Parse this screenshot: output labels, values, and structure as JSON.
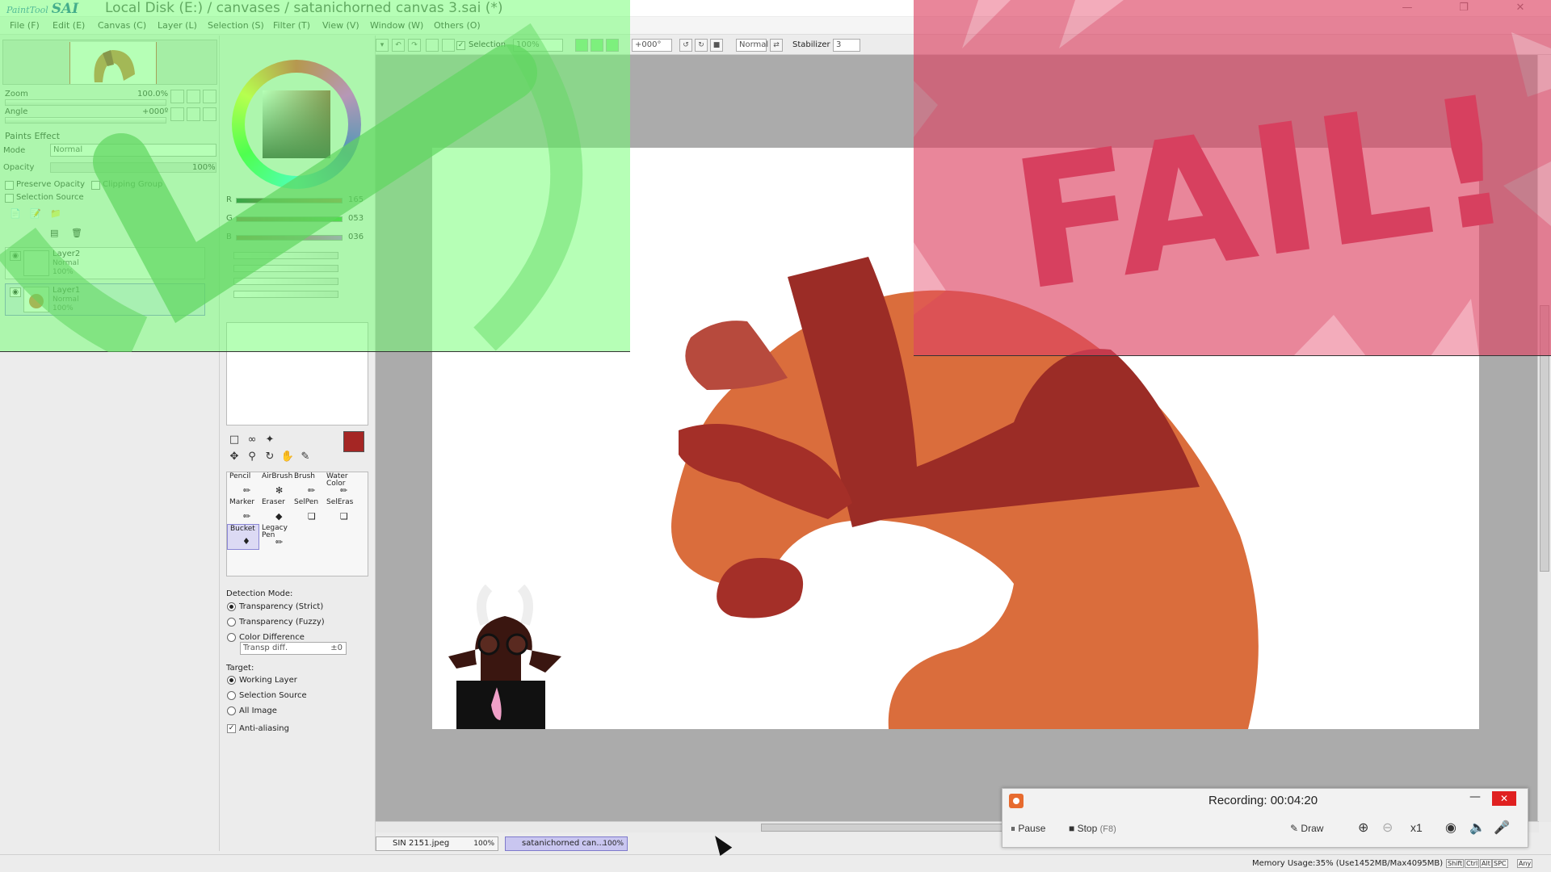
{
  "window": {
    "logo_small": "PaintTool",
    "logo_big": "SAI",
    "title": "Local Disk (E:) / canvases / satanichorned canvas 3.sai (*)",
    "btn_min": "—",
    "btn_max": "❐",
    "btn_close": "✕"
  },
  "menu": [
    "File (F)",
    "Edit (E)",
    "Canvas (C)",
    "Layer (L)",
    "Selection (S)",
    "Filter (T)",
    "View (V)",
    "Window (W)",
    "Others (O)"
  ],
  "navigator": {
    "zoom_label": "Zoom",
    "zoom_value": "100.0%",
    "angle_label": "Angle",
    "angle_value": "+000º"
  },
  "layer_panel": {
    "paints_effect": "Paints Effect",
    "mode_label": "Mode",
    "mode_value": "Normal",
    "opacity_label": "Opacity",
    "opacity_value": "100%",
    "preserve_opacity": "Preserve Opacity",
    "clipping_group": "Clipping Group",
    "selection_source": "Selection Source",
    "layers": [
      {
        "name": "Layer2",
        "mode": "Normal",
        "opacity": "100%"
      },
      {
        "name": "Layer1",
        "mode": "Normal",
        "opacity": "100%"
      }
    ]
  },
  "color": {
    "r_label": "R",
    "r_value": "165",
    "g_label": "G",
    "g_value": "053",
    "b_label": "B",
    "b_value": "036",
    "primary": "#a52624",
    "secondary": "#c49a8a"
  },
  "tools": [
    {
      "name": "Pencil",
      "icon": "pencil-icon"
    },
    {
      "name": "AirBrush",
      "icon": "airbrush-icon"
    },
    {
      "name": "Brush",
      "icon": "brush-icon"
    },
    {
      "name": "Water Color",
      "icon": "watercolor-icon"
    },
    {
      "name": "Marker",
      "icon": "marker-icon"
    },
    {
      "name": "Eraser",
      "icon": "eraser-icon"
    },
    {
      "name": "SelPen",
      "icon": "selpen-icon"
    },
    {
      "name": "SelEras",
      "icon": "seleras-icon"
    },
    {
      "name": "Bucket",
      "icon": "bucket-icon"
    },
    {
      "name": "Legacy Pen",
      "icon": "legacy-pen-icon"
    }
  ],
  "tool_options": {
    "detection_mode": "Detection Mode:",
    "modes": [
      "Transparency (Strict)",
      "Transparency (Fuzzy)",
      "Color Difference"
    ],
    "transp_diff_label": "Transp diff.",
    "transp_diff_value": "±0",
    "target": "Target:",
    "targets": [
      "Working Layer",
      "Selection Source",
      "All Image"
    ],
    "anti_aliasing": "Anti-aliasing"
  },
  "toolbar": {
    "selection_label": "Selection",
    "zoom_value": "100%",
    "angle_value": "+000°",
    "blend_mode": "Normal",
    "stabilizer_label": "Stabilizer",
    "stabilizer_value": "3"
  },
  "overlays": {
    "fail_text": "FAIL!"
  },
  "doc_tabs": [
    {
      "name": "SIN 2151.jpeg",
      "zoom": "100%"
    },
    {
      "name": "satanichorned can...",
      "zoom": "100%"
    }
  ],
  "status": {
    "memory": "Memory Usage:35% (Use1452MB/Max4095MB)",
    "keys": [
      "Shift",
      "Ctrl",
      "Alt",
      "SPC",
      "Any"
    ]
  },
  "recorder": {
    "title": "Recording:  00:04:20",
    "pause": "Pause",
    "stop": "Stop",
    "stop_key": "(F8)",
    "draw": "Draw",
    "zoom_level": "x1"
  }
}
